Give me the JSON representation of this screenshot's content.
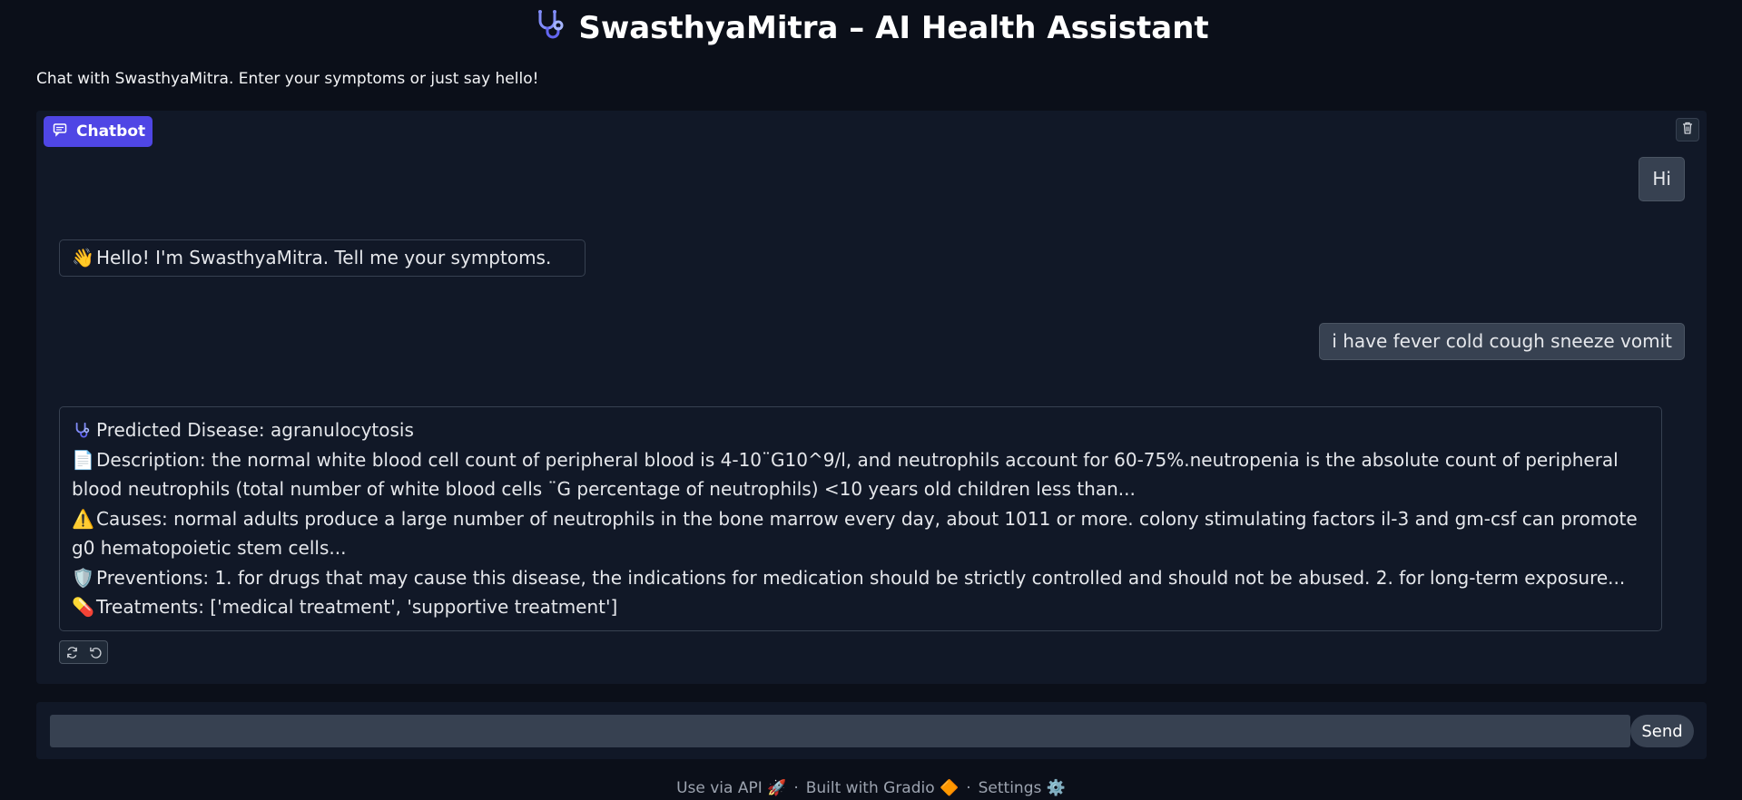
{
  "app": {
    "title": "SwasthyaMitra – AI Health Assistant",
    "subtitle": "Chat with SwasthyaMitra. Enter your symptoms or just say hello!",
    "icon": "stethoscope-icon"
  },
  "chatbot": {
    "label": "Chatbot",
    "messages": [
      {
        "role": "user",
        "text": "Hi"
      },
      {
        "role": "bot",
        "emoji": "👋",
        "text": "Hello! I'm SwasthyaMitra. Tell me your symptoms."
      },
      {
        "role": "user",
        "text": "i have fever cold cough sneeze vomit"
      },
      {
        "role": "bot",
        "lines": [
          {
            "icon": "stethoscope-icon",
            "text": "Predicted Disease: agranulocytosis"
          },
          {
            "emoji": "📄",
            "text": "Description: the normal white blood cell count of peripheral blood is 4-10¨G10^9/l, and neutrophils account for 60-75%.neutropenia is the absolute count of peripheral blood neutrophils (total number of white blood cells ¨G percentage of neutrophils) <10 years old children less than..."
          },
          {
            "emoji": "⚠️",
            "text": "Causes: normal adults produce a large number of neutrophils in the bone marrow every day, about 1011 or more. colony stimulating factors il-3 and gm-csf can promote g0 hematopoietic stem cells..."
          },
          {
            "emoji": "🛡️",
            "text": "Preventions: 1. for drugs that may cause this disease, the indications for medication should be strictly controlled and should not be abused. 2. for long-term exposure..."
          },
          {
            "emoji": "💊",
            "text": "Treatments: ['medical treatment', 'supportive treatment']"
          }
        ]
      }
    ]
  },
  "input": {
    "value": "",
    "placeholder": "",
    "send_label": "Send"
  },
  "footer": {
    "api_label": "Use via API",
    "api_emoji": "🚀",
    "built_label": "Built with Gradio",
    "built_emoji": "🔶",
    "settings_label": "Settings",
    "settings_emoji": "⚙️",
    "separator": "·"
  }
}
